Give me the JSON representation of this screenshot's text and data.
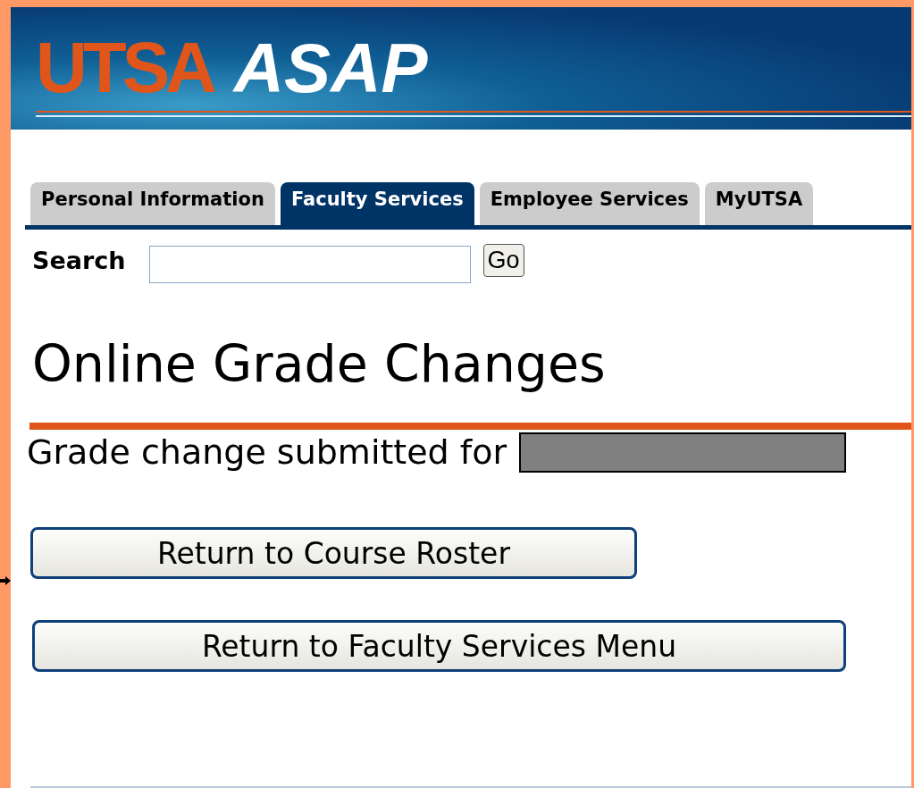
{
  "header": {
    "logo_mark": "UTSA",
    "logo_text": "ASAP"
  },
  "tabs": [
    {
      "label": "Personal Information",
      "selected": false
    },
    {
      "label": "Faculty Services",
      "selected": true
    },
    {
      "label": "Employee Services",
      "selected": false
    },
    {
      "label": "MyUTSA",
      "selected": false
    }
  ],
  "search": {
    "label": "Search",
    "button": "Go"
  },
  "title": "Online Grade Changes",
  "message": {
    "text": "Grade change submitted for",
    "redacted": true
  },
  "buttons": [
    "Return to Course Roster",
    "Return to Faculty Services Menu"
  ]
}
